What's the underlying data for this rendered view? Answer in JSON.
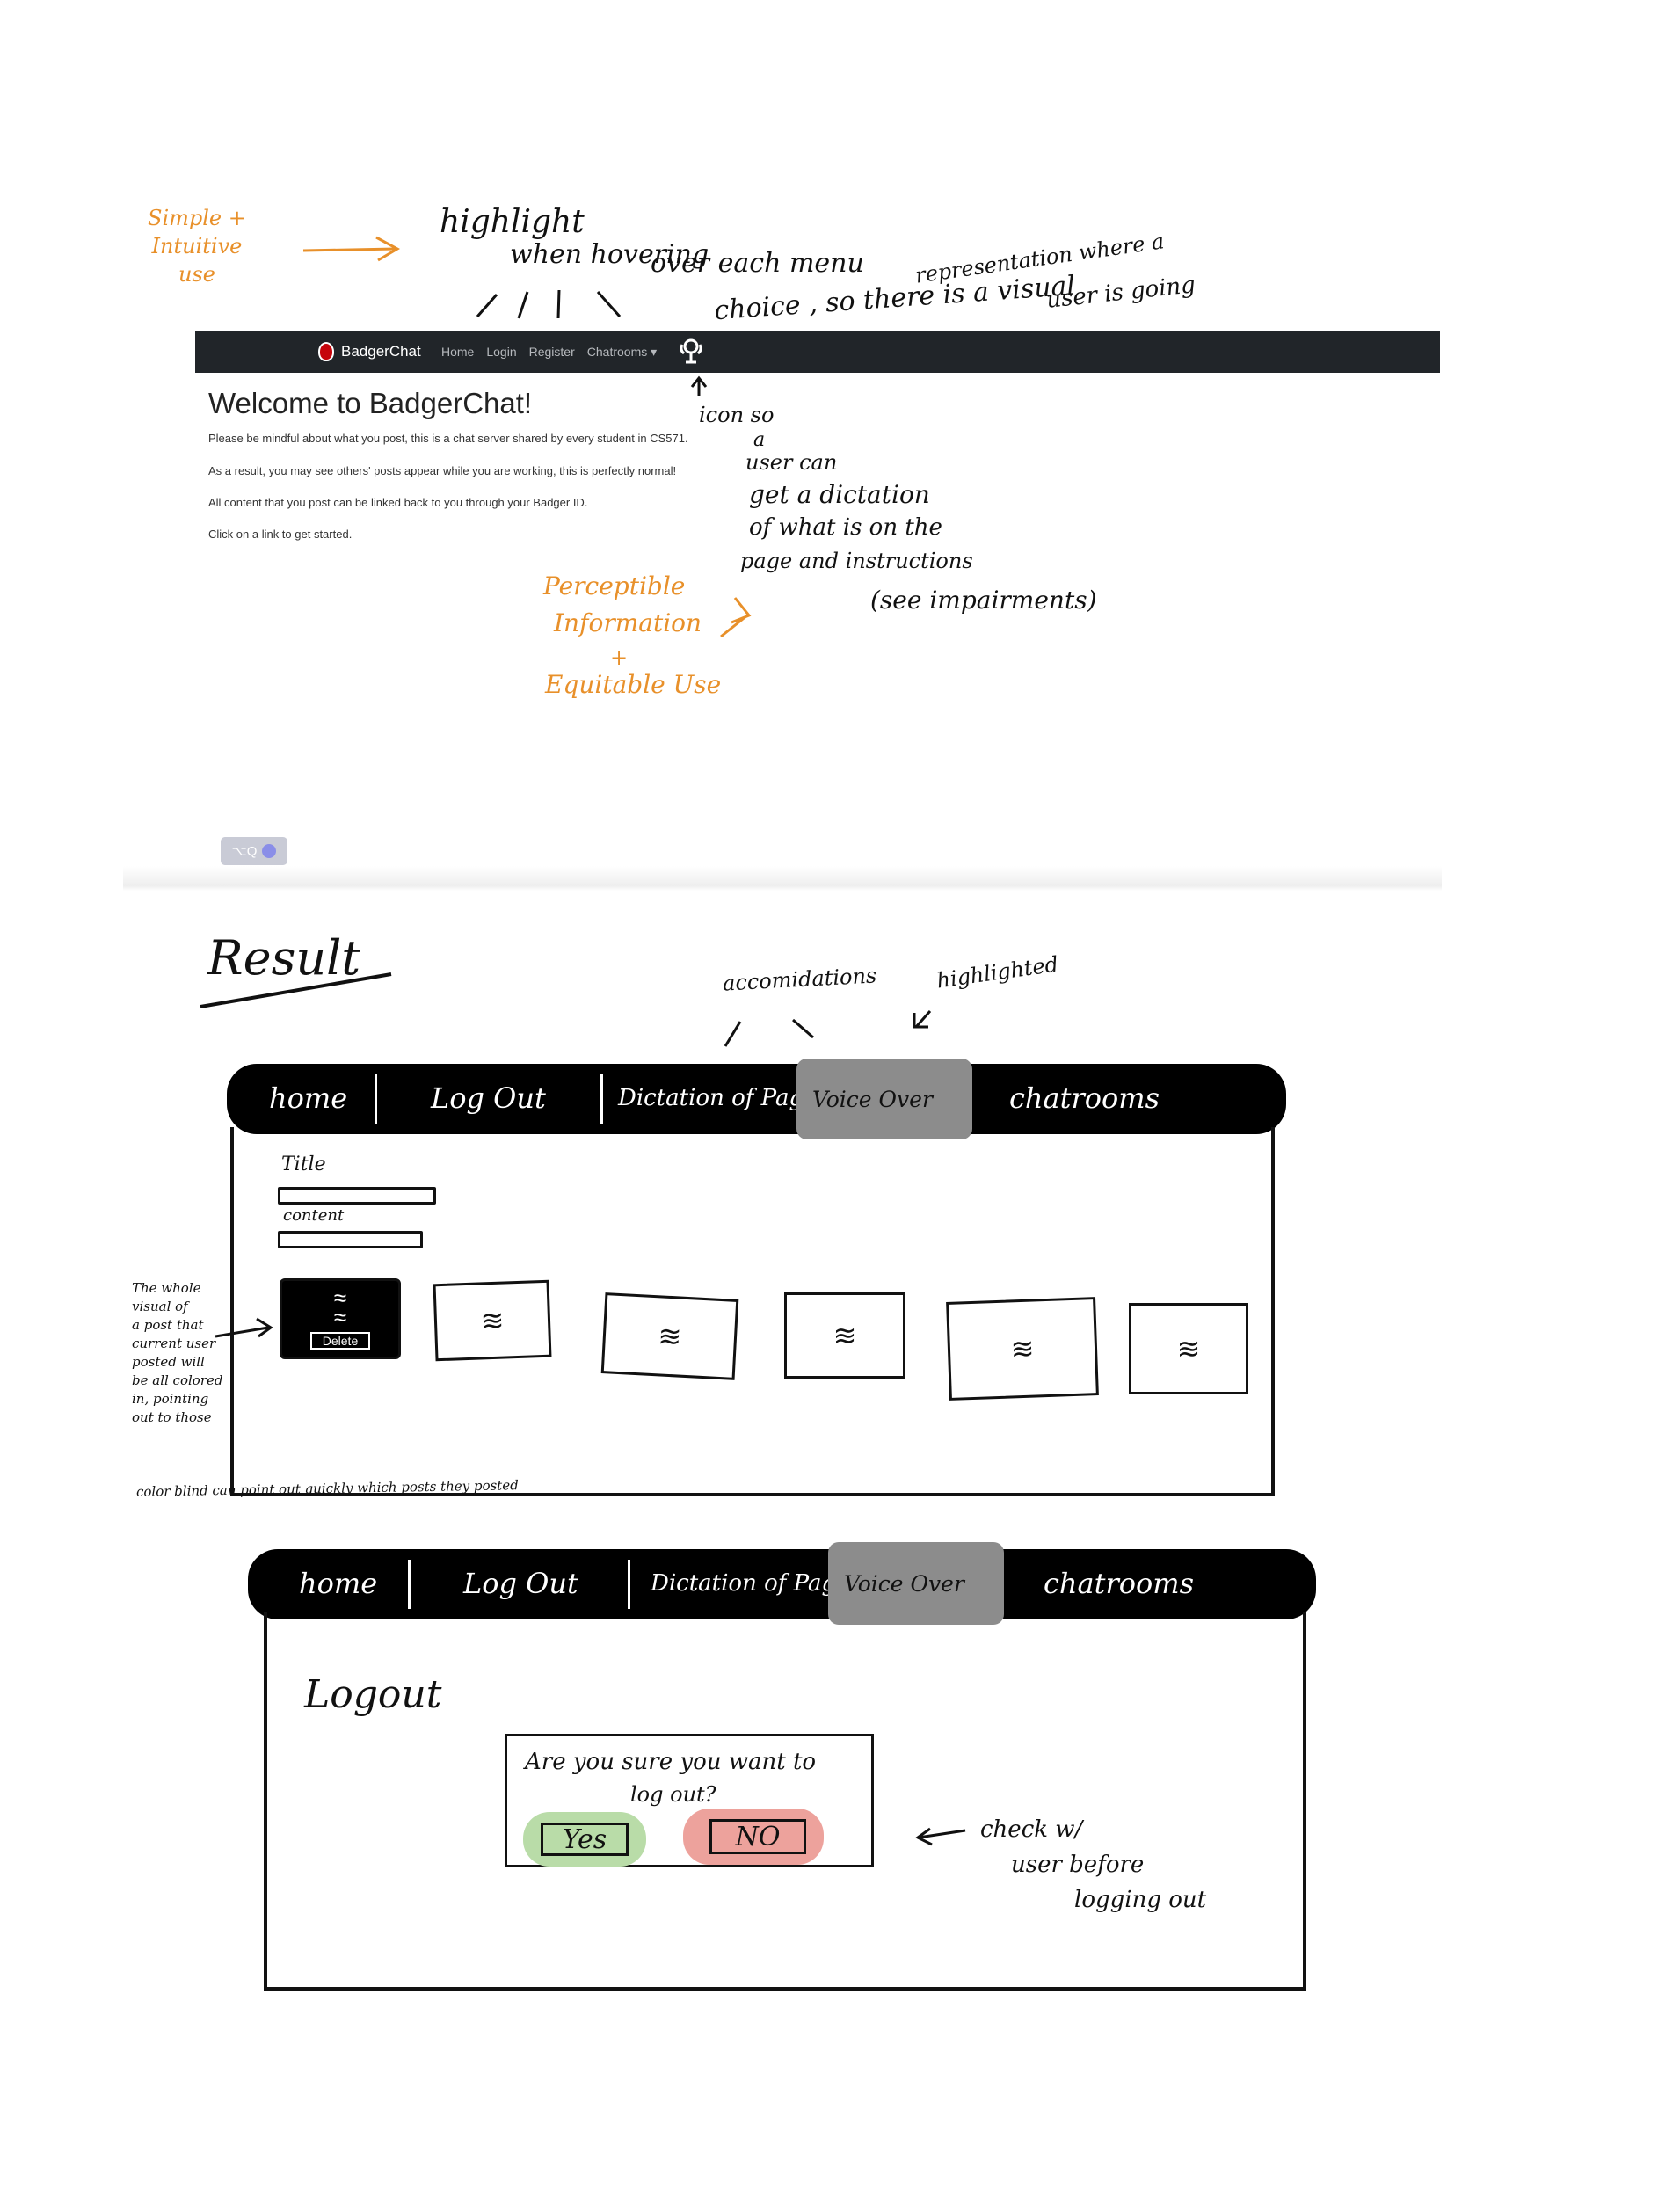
{
  "annotations": {
    "simple": "Simple +\nIntuitive\nuse",
    "highlight_1": "highlight",
    "highlight_2": "when hovering",
    "over_each_menu": "over each menu",
    "choice": "choice , so there is a visual",
    "representation": "representation where a",
    "user_is_going": "user is going",
    "icon_so": "icon so",
    "a": "a",
    "user_can": "user can",
    "get_dictation": "get a dictation",
    "of_what": "of what is on the",
    "page_instructions": "page and instructions",
    "see_impairments": "(see impairments)",
    "perceptible_1": "Perceptible",
    "perceptible_2": "Information",
    "perceptible_3": "+",
    "perceptible_4": "Equitable Use",
    "result": "Result",
    "accommodations": "accomidations",
    "highlighted": "highlighted",
    "whole_visual": "The whole\nvisual of\na post that\ncurrent user\nposted will\nbe all colored\nin, pointing\nout to those",
    "color_blind": "color blind can point out quickly which posts they posted",
    "check_user_1": "check w/",
    "check_user_2": "user before",
    "check_user_3": "logging out"
  },
  "screenshot": {
    "brand": "BadgerChat",
    "nav": [
      "Home",
      "Login",
      "Register",
      "Chatrooms ▾"
    ],
    "voice_icon": "accessibility-voice-icon",
    "heading": "Welcome to BadgerChat!",
    "paragraphs": [
      "Please be mindful about what you post, this is a chat server shared by every student in CS571.",
      "As a result, you may see others' posts appear while you are working, this is perfectly normal!",
      "All content that you post can be linked back to you through your Badger ID.",
      "Click on a link to get started."
    ],
    "shortcut": "⌥Q"
  },
  "sketch1": {
    "nav": {
      "home": "home",
      "logout": "Log Out",
      "dictation": "Dictation of Page",
      "voice_over": "Voice Over",
      "chatrooms": "chatrooms"
    },
    "title_label": "Title",
    "content_label": "content",
    "delete_label": "Delete"
  },
  "sketch2": {
    "nav": {
      "home": "home",
      "logout": "Log Out",
      "dictation": "Dictation of Page",
      "voice_over": "Voice Over",
      "chatrooms": "chatrooms"
    },
    "heading": "Logout",
    "question_1": "Are you sure you want to",
    "question_2": "log out?",
    "yes": "Yes",
    "no": "NO"
  },
  "colors": {
    "orange": "#e8902a",
    "navbar": "#212529",
    "highlight_gray": "#8c8c8c",
    "yes_green": "#b9dca8",
    "no_red": "#eda29c"
  }
}
